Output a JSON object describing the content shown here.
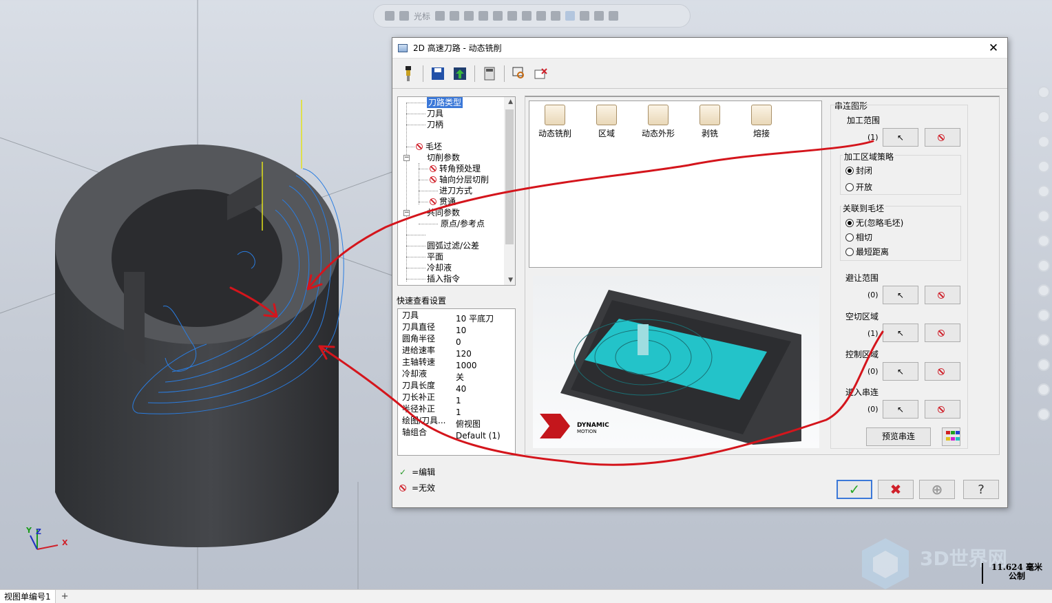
{
  "app": {
    "topbar_label": "光标",
    "view_tab": "视图单编号1",
    "add_tab": "+",
    "scale_value": "11.624 毫米",
    "scale_unit": "公制",
    "watermark": "3D世界网",
    "axis_labels": {
      "y": "Y",
      "z": "Z",
      "x": "X"
    }
  },
  "dialog": {
    "title": "2D 高速刀路 - 动态铣削",
    "close": "✕",
    "toolbar_icons": [
      "tool-icon",
      "save-icon",
      "save-green-icon",
      "calculator-icon",
      "view-zoom-icon",
      "delete-red-icon"
    ],
    "tree": [
      {
        "label": "刀路类型",
        "selected": true
      },
      {
        "label": "刀具"
      },
      {
        "label": "刀柄"
      },
      {
        "label": "毛坯",
        "invalid": true
      },
      {
        "label": "切削参数"
      },
      {
        "label": "转角预处理",
        "invalid": true
      },
      {
        "label": "轴向分层切削",
        "invalid": true
      },
      {
        "label": "进刀方式"
      },
      {
        "label": "贯通",
        "invalid": true
      },
      {
        "label": "共同参数"
      },
      {
        "label": "原点/参考点"
      },
      {
        "label": "圆弧过滤/公差"
      },
      {
        "label": "平面"
      },
      {
        "label": "冷却液"
      },
      {
        "label": "插入指令"
      }
    ],
    "quick_view_title": "快速查看设置",
    "quick_view": [
      {
        "k": "刀具",
        "v": "10 平底刀"
      },
      {
        "k": "刀具直径",
        "v": "10"
      },
      {
        "k": "圆角半径",
        "v": "0"
      },
      {
        "k": "进给速率",
        "v": "120"
      },
      {
        "k": "主轴转速",
        "v": "1000"
      },
      {
        "k": "冷却液",
        "v": "关"
      },
      {
        "k": "刀具长度",
        "v": "40"
      },
      {
        "k": "刀长补正",
        "v": "1"
      },
      {
        "k": "半径补正",
        "v": "1"
      },
      {
        "k": "绘图/刀具...",
        "v": "俯视图"
      },
      {
        "k": "轴组合",
        "v": "Default (1)"
      }
    ],
    "legend_edit": "=编辑",
    "legend_invalid": "=无效",
    "toolpath_types": [
      {
        "label": "动态铣削",
        "icon": "dynamic-mill-icon"
      },
      {
        "label": "区域",
        "icon": "area-icon"
      },
      {
        "label": "动态外形",
        "icon": "dynamic-contour-icon"
      },
      {
        "label": "剥铣",
        "icon": "peel-mill-icon"
      },
      {
        "label": "熔接",
        "icon": "blend-icon"
      }
    ],
    "preview_brand": "DYNAMIC",
    "preview_brand_sub": "MOTION",
    "chain": {
      "title": "串连图形",
      "machining_area": {
        "label": "加工范围",
        "count": "(1)"
      },
      "strategy": {
        "title": "加工区域策略",
        "options": [
          "封闭",
          "开放"
        ],
        "selected": 0
      },
      "stock": {
        "title": "关联到毛坯",
        "options": [
          "无(忽略毛坯)",
          "相切",
          "最短距离"
        ],
        "selected": 0
      },
      "avoid": {
        "label": "避让范围",
        "count": "(0)"
      },
      "air": {
        "label": "空切区域",
        "count": "(1)"
      },
      "control": {
        "label": "控制区域",
        "count": "(0)"
      },
      "entry": {
        "label": "进入串连",
        "count": "(0)"
      },
      "preview_button": "预览串连"
    },
    "colors": {
      "accent": "#3b78d8",
      "arrow": "#d4151c",
      "toolpath": "#2a7de1"
    }
  }
}
